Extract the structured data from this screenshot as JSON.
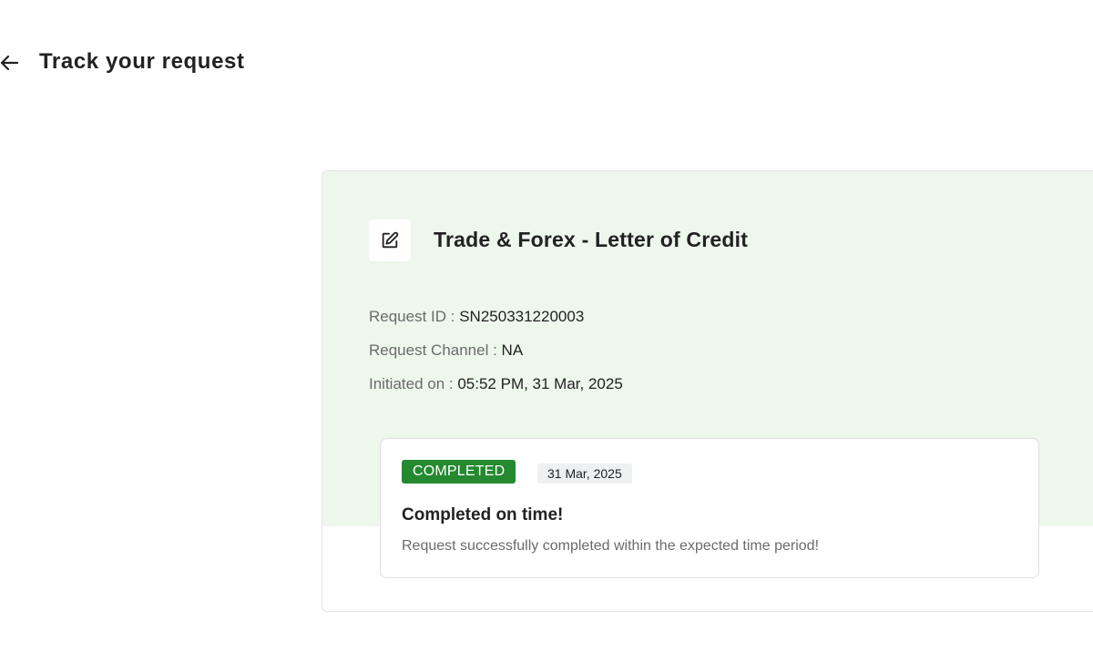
{
  "header": {
    "back_icon": "arrow-left-icon",
    "title": "Track your request"
  },
  "request": {
    "type_icon": "edit-icon",
    "title": "Trade & Forex - Letter of Credit",
    "id_label": "Request ID : ",
    "id_value": "SN250331220003",
    "channel_label": "Request Channel : ",
    "channel_value": "NA",
    "initiated_label": "Initiated on : ",
    "initiated_value": "05:52 PM, 31 Mar, 2025"
  },
  "status": {
    "badge": "COMPLETED",
    "date": "31 Mar, 2025",
    "title": "Completed on time!",
    "description": "Request successfully completed within the expected time period!"
  },
  "colors": {
    "card_tint": "#edf7ec",
    "status_green": "#24892f",
    "date_chip": "#eef0f1"
  }
}
